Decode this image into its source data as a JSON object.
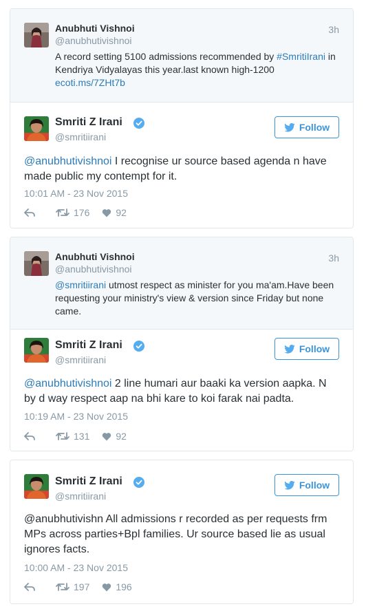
{
  "threads": [
    {
      "quoted": {
        "name": "Anubhuti Vishnoi",
        "handle": "@anubhutivishnoi",
        "time": "3h",
        "text_plain_1": "A record setting 5100 admissions recommended by ",
        "text_link_1": "#SmritiIrani",
        "text_plain_2": " in Kendriya Vidyalayas this year.last known high-1200",
        "text_link_2": "ecoti.ms/7ZHt7b"
      },
      "reply": {
        "name": "Smriti Z Irani",
        "handle": "@smritiirani",
        "follow_label": "Follow",
        "mention": "@anubhutivishnoi",
        "text": " I recognise ur source based agenda n have made public my contempt for it.",
        "date": "10:01 AM - 23 Nov 2015",
        "retweets": "176",
        "likes": "92"
      }
    },
    {
      "quoted": {
        "name": "Anubhuti Vishnoi",
        "handle": "@anubhutivishnoi",
        "time": "3h",
        "mention": "@smritiirani",
        "text": " utmost respect as minister for you ma'am.Have been requesting your ministry's view & version since Friday but none came."
      },
      "reply": {
        "name": "Smriti Z Irani",
        "handle": "@smritiirani",
        "follow_label": "Follow",
        "mention": "@anubhutivishnoi",
        "text": " 2 line humari aur baaki ka version aapka. N by d way respect aap na bhi  kare to koi farak nai padta.",
        "date": "10:19 AM - 23 Nov 2015",
        "retweets": "131",
        "likes": "92"
      }
    },
    {
      "reply": {
        "name": "Smriti Z Irani",
        "handle": "@smritiirani",
        "follow_label": "Follow",
        "text": "@anubhutivishn All admissions r recorded as per requests frm MPs across parties+Bpl families. Ur source based lie as usual ignores facts.",
        "date": "10:00 AM - 23 Nov 2015",
        "retweets": "197",
        "likes": "196"
      }
    }
  ],
  "colors": {
    "link": "#2b7bb9",
    "follow_blue": "#3b94d9",
    "muted": "#8899a6",
    "border": "#e1e8ed",
    "quoted_bg": "#f5f8fa"
  },
  "icons": [
    "reply-icon",
    "retweet-icon",
    "heart-icon",
    "twitter-bird-icon",
    "verified-badge-icon"
  ]
}
